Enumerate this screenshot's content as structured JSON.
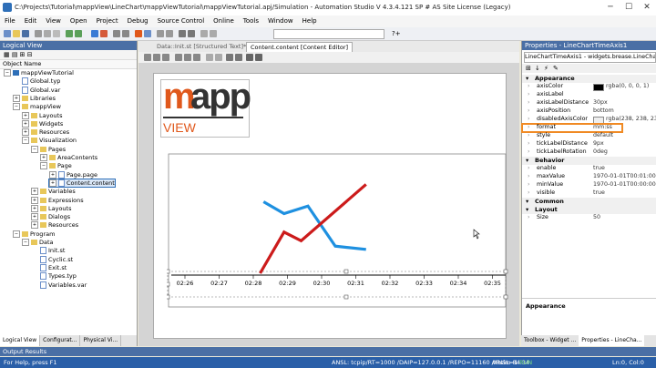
{
  "window": {
    "title": "C:\\Projects\\Tutorial\\mappView\\LineChart\\mappViewTutorial\\mappViewTutorial.apj/Simulation - Automation Studio V 4.3.4.121 SP # AS Site License (Legacy)",
    "minimize": "─",
    "maximize": "☐",
    "close": "✕"
  },
  "menu": [
    "File",
    "Edit",
    "View",
    "Open",
    "Project",
    "Debug",
    "Source Control",
    "Online",
    "Tools",
    "Window",
    "Help"
  ],
  "toolbar": {
    "zoom": "?+"
  },
  "logical_view": {
    "header": "Logical View",
    "column": "Object Name",
    "tree": [
      {
        "label": "mappViewTutorial",
        "level": 0,
        "expander": "−",
        "icon": "project-icon"
      },
      {
        "label": "Global.typ",
        "level": 1,
        "expander": "",
        "icon": "file-icon"
      },
      {
        "label": "Global.var",
        "level": 1,
        "expander": "",
        "icon": "file-icon"
      },
      {
        "label": "Libraries",
        "level": 1,
        "expander": "+",
        "icon": "folder-icon"
      },
      {
        "label": "mappView",
        "level": 1,
        "expander": "−",
        "icon": "folder-icon"
      },
      {
        "label": "Layouts",
        "level": 2,
        "expander": "+",
        "icon": "folder-icon"
      },
      {
        "label": "Widgets",
        "level": 2,
        "expander": "+",
        "icon": "folder-icon"
      },
      {
        "label": "Resources",
        "level": 2,
        "expander": "+",
        "icon": "folder-icon"
      },
      {
        "label": "Visualization",
        "level": 2,
        "expander": "−",
        "icon": "folder-icon"
      },
      {
        "label": "Pages",
        "level": 3,
        "expander": "−",
        "icon": "folder-icon"
      },
      {
        "label": "AreaContents",
        "level": 4,
        "expander": "+",
        "icon": "folder-icon"
      },
      {
        "label": "Page",
        "level": 4,
        "expander": "−",
        "icon": "folder-icon"
      },
      {
        "label": "Page.page",
        "level": 5,
        "expander": "+",
        "icon": "file-icon"
      },
      {
        "label": "Content.content",
        "level": 5,
        "expander": "+",
        "icon": "file-icon",
        "selected": true
      },
      {
        "label": "Variables",
        "level": 3,
        "expander": "+",
        "icon": "folder-icon"
      },
      {
        "label": "Expressions",
        "level": 3,
        "expander": "+",
        "icon": "folder-icon"
      },
      {
        "label": "Layouts",
        "level": 3,
        "expander": "+",
        "icon": "folder-icon"
      },
      {
        "label": "Dialogs",
        "level": 3,
        "expander": "+",
        "icon": "folder-icon"
      },
      {
        "label": "Resources",
        "level": 3,
        "expander": "+",
        "icon": "folder-icon"
      },
      {
        "label": "Program",
        "level": 1,
        "expander": "−",
        "icon": "folder-icon"
      },
      {
        "label": "Data",
        "level": 2,
        "expander": "−",
        "icon": "folder-icon"
      },
      {
        "label": "Init.st",
        "level": 3,
        "expander": "",
        "icon": "file-icon"
      },
      {
        "label": "Cyclic.st",
        "level": 3,
        "expander": "",
        "icon": "file-icon"
      },
      {
        "label": "Exit.st",
        "level": 3,
        "expander": "",
        "icon": "file-icon"
      },
      {
        "label": "Types.typ",
        "level": 3,
        "expander": "",
        "icon": "file-icon"
      },
      {
        "label": "Variables.var",
        "level": 3,
        "expander": "",
        "icon": "file-icon"
      }
    ],
    "bottom_tabs": [
      "Logical View",
      "Configurat...",
      "Physical Vi..."
    ]
  },
  "doc_tabs": [
    {
      "label": "Data::Init.st [Structured Text]*",
      "active": false
    },
    {
      "label": "Content.content [Content Editor]",
      "active": true
    }
  ],
  "logo": {
    "brand_m": "m",
    "brand_rest": "app",
    "sub": "VIEW"
  },
  "chart_data": {
    "type": "line",
    "x_ticks": [
      "02:26",
      "02:27",
      "02:28",
      "02:29",
      "02:30",
      "02:31",
      "02:32",
      "02:33",
      "02:34",
      "02:35"
    ],
    "series": [
      {
        "color": "#1e90e0",
        "values": [
          [
            2.3,
            0.66
          ],
          [
            2.9,
            0.55
          ],
          [
            3.6,
            0.62
          ],
          [
            4.4,
            0.25
          ],
          [
            5.3,
            0.22
          ]
        ]
      },
      {
        "color": "#cc1b1b",
        "values": [
          [
            2.2,
            0.0
          ],
          [
            2.9,
            0.38
          ],
          [
            3.4,
            0.3
          ],
          [
            5.3,
            0.82
          ]
        ]
      }
    ]
  },
  "properties": {
    "header": "Properties - LineChartTimeAxis1",
    "selector": "LineChartTimeAxis1 - widgets.brease.LineChartT",
    "categories": [
      {
        "name": "Appearance",
        "rows": [
          {
            "key": "axisColor",
            "value": "rgba(0, 0, 0, 1)",
            "swatch": "#000000"
          },
          {
            "key": "axisLabel",
            "value": ""
          },
          {
            "key": "axisLabelDistance",
            "value": "30px"
          },
          {
            "key": "axisPosition",
            "value": "bottom"
          },
          {
            "key": "disabledAxisColor",
            "value": "rgba(238, 238, 238",
            "swatch": "#eeeeee"
          },
          {
            "key": "format",
            "value": "mm:ss",
            "highlight": true
          },
          {
            "key": "style",
            "value": "default"
          },
          {
            "key": "tickLabelDistance",
            "value": "9px"
          },
          {
            "key": "tickLabelRotation",
            "value": "0deg"
          }
        ]
      },
      {
        "name": "Behavior",
        "rows": [
          {
            "key": "enable",
            "value": "true"
          },
          {
            "key": "maxValue",
            "value": "1970-01-01T00:01:00.00"
          },
          {
            "key": "minValue",
            "value": "1970-01-01T00:00:00.00"
          },
          {
            "key": "visible",
            "value": "true"
          }
        ]
      },
      {
        "name": "Common",
        "rows": []
      },
      {
        "name": "Layout",
        "rows": [
          {
            "key": "Size",
            "value": "50"
          }
        ]
      }
    ],
    "description_title": "Appearance",
    "tabs": [
      "Toolbox - Widget ...",
      "Properties - LineCha..."
    ]
  },
  "output": {
    "header": "Output Results"
  },
  "status": {
    "help": "For Help, press F1",
    "connection": "ANSL: tcpip/RT=1000 /DAIP=127.0.0.1 /REPO=11160 /ANSL=1",
    "arsim": "ARsim  84.34",
    "run": "RUN",
    "position": "Ln:0, Col:0"
  }
}
